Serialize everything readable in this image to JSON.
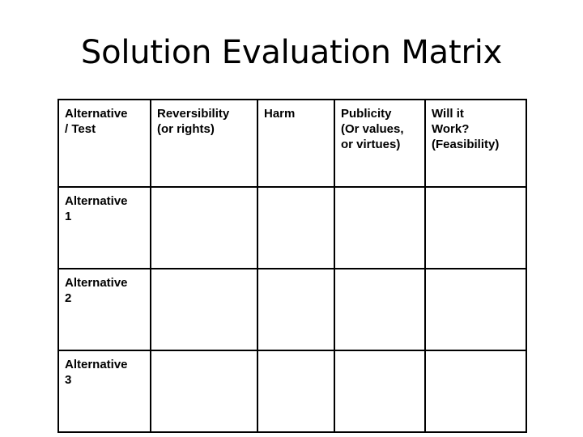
{
  "slide": {
    "title": "Solution Evaluation Matrix",
    "background_color": "#FFFFFF",
    "text_color": "#000000",
    "border_color": "#000000"
  },
  "matrix": {
    "headers": [
      {
        "line1": "Alternative",
        "line2": "/ Test",
        "line3": ""
      },
      {
        "line1": "Reversibility",
        "line2": "(or rights)",
        "line3": ""
      },
      {
        "line1": "Harm",
        "line2": "",
        "line3": ""
      },
      {
        "line1": "Publicity",
        "line2": "(Or values,",
        "line3": "or virtues)"
      },
      {
        "line1": "Will it",
        "line2": "Work?",
        "line3": "(Feasibility)"
      }
    ],
    "rows": [
      {
        "label_line1": "Alternative",
        "label_line2": "1",
        "reversibility": "",
        "harm": "",
        "publicity": "",
        "will_it_work": ""
      },
      {
        "label_line1": "Alternative",
        "label_line2": "2",
        "reversibility": "",
        "harm": "",
        "publicity": "",
        "will_it_work": ""
      },
      {
        "label_line1": "Alternative",
        "label_line2": "3",
        "reversibility": "",
        "harm": "",
        "publicity": "",
        "will_it_work": ""
      }
    ]
  }
}
